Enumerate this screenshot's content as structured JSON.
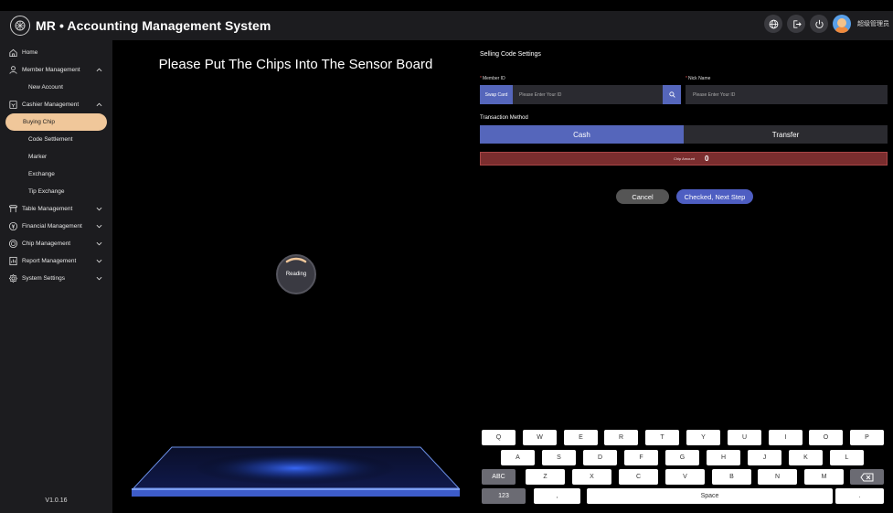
{
  "header": {
    "title": "MR • Accounting Management System",
    "user_name": "超级管理员",
    "icons": [
      "globe-icon",
      "logout-icon",
      "power-icon"
    ]
  },
  "sidebar": {
    "items": [
      {
        "label": "Home",
        "icon": "home-icon"
      },
      {
        "label": "Member Management",
        "icon": "member-icon",
        "expanded": true
      },
      {
        "label": "New Account",
        "sub": true
      },
      {
        "label": "Cashier Management",
        "icon": "cashier-icon",
        "expanded": true
      },
      {
        "label": "Buying Chip",
        "sub": true,
        "active": true
      },
      {
        "label": "Code Settlement",
        "sub": true
      },
      {
        "label": "Marker",
        "sub": true
      },
      {
        "label": "Exchange",
        "sub": true
      },
      {
        "label": "Tip Exchange",
        "sub": true
      },
      {
        "label": "Table Management",
        "icon": "table-icon"
      },
      {
        "label": "Financial Management",
        "icon": "finance-icon"
      },
      {
        "label": "Chip Management",
        "icon": "chip-icon"
      },
      {
        "label": "Report Management",
        "icon": "report-icon"
      },
      {
        "label": "System Settings",
        "icon": "settings-icon"
      }
    ],
    "version": "V1.0.16",
    "active_color": "#f0c79a"
  },
  "reader": {
    "title": "Please Put The Chips Into The Sensor Board",
    "status": "Reading"
  },
  "form": {
    "title": "Selling Code Settings",
    "member_id_label": "Member ID",
    "swap_card_label": "Swap Card",
    "member_id_placeholder": "Please Enter Your ID",
    "nick_name_label": "Nick Name",
    "nick_name_placeholder": "Please Enter Your ID",
    "transaction_method_label": "Transaction Method",
    "methods": [
      "Cash",
      "Transfer"
    ],
    "selected_method": "Cash",
    "chip_amount_label": "Chip Amount",
    "chip_amount_value": "0",
    "cancel_label": "Cancel",
    "next_label": "Checked, Next Step",
    "accent_color": "#5566bb"
  },
  "keyboard": {
    "row1": [
      "Q",
      "W",
      "E",
      "R",
      "T",
      "Y",
      "U",
      "I",
      "O",
      "P"
    ],
    "row2": [
      "A",
      "S",
      "D",
      "F",
      "G",
      "H",
      "J",
      "K",
      "L"
    ],
    "row3_mode": "ABC",
    "row3": [
      "Z",
      "X",
      "C",
      "V",
      "B",
      "N",
      "M"
    ],
    "row4_mode": "123",
    "comma": ",",
    "space": "Space",
    "period": "."
  }
}
